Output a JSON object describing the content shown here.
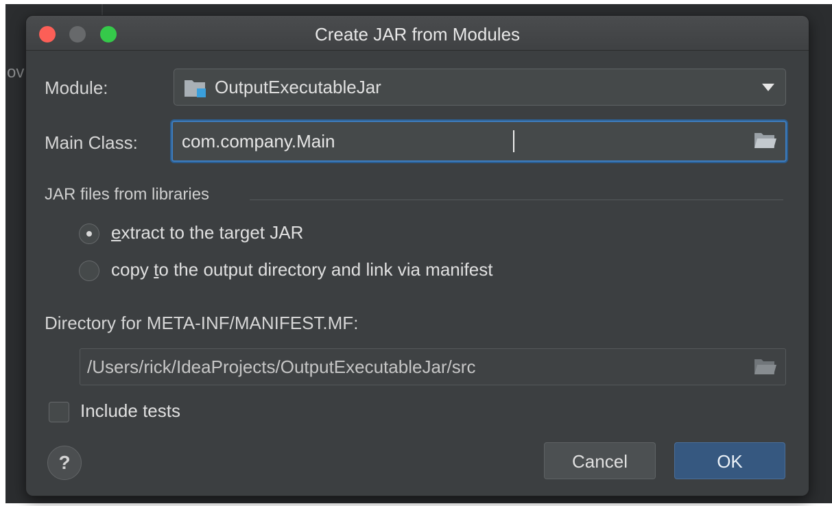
{
  "background": {
    "partial_text": "ov"
  },
  "dialog": {
    "title": "Create JAR from Modules",
    "module_label": "Module:",
    "module_value": "OutputExecutableJar",
    "main_class_label": "Main Class:",
    "main_class_value": "com.company.Main",
    "jar_group_label": "JAR files from libraries",
    "radio_options": [
      {
        "label_prefix": "",
        "mnemonic": "e",
        "label_rest": "xtract to the target JAR",
        "checked": true
      },
      {
        "label_prefix": "copy ",
        "mnemonic": "t",
        "label_rest": "o the output directory and link via manifest",
        "checked": false
      }
    ],
    "manifest_dir_label": "Directory for META-INF/MANIFEST.MF:",
    "manifest_dir_value": "/Users/rick/IdeaProjects/OutputExecutableJar/src",
    "include_tests_label": "Include tests",
    "include_tests_checked": false,
    "help_label": "?",
    "cancel_label": "Cancel",
    "ok_label": "OK"
  },
  "icons": {
    "folder": "folder-icon",
    "module": "module-folder-icon",
    "dropdown": "chevron-down-icon",
    "help": "help-icon"
  },
  "colors": {
    "dialog_bg": "#3c3f41",
    "focus_border": "#3d7dbf",
    "ok_button": "#365880",
    "close": "#fc5f57",
    "maximize": "#35c94a"
  }
}
